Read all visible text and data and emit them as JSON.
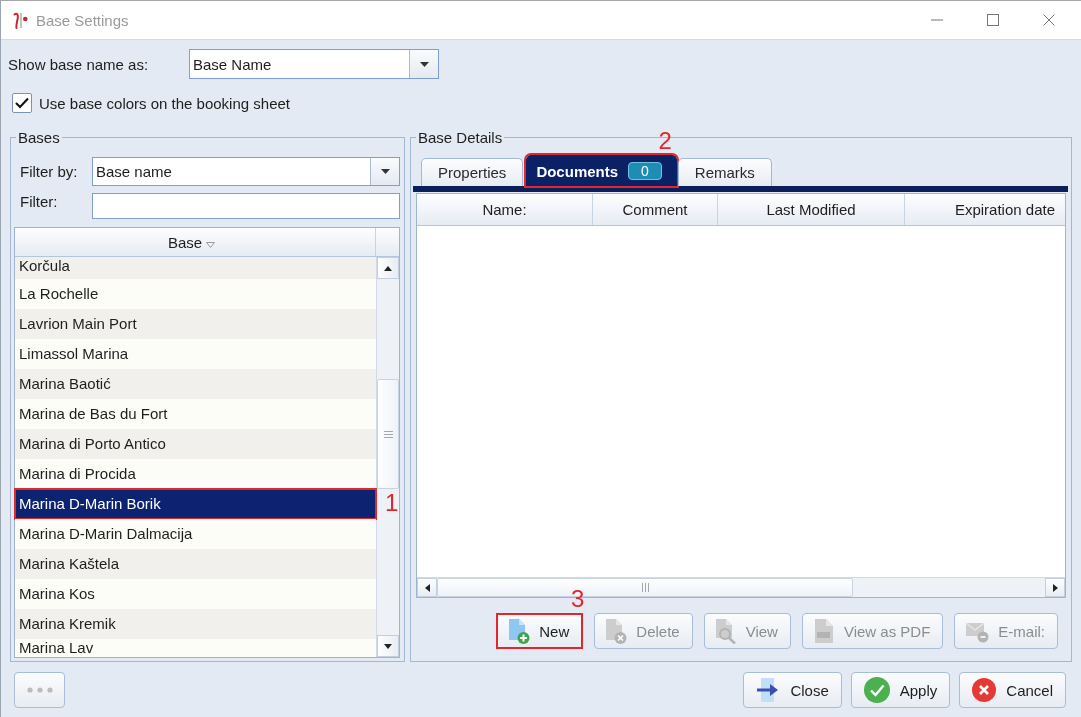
{
  "window": {
    "title": "Base Settings"
  },
  "display": {
    "label": "Show base name as:",
    "value": "Base Name"
  },
  "use_colors": {
    "label": "Use base colors on the booking sheet",
    "checked": true
  },
  "bases": {
    "title": "Bases",
    "filter_by": {
      "label": "Filter by:",
      "value": "Base name"
    },
    "filter": {
      "label": "Filter:"
    },
    "column": "Base",
    "rows": [
      {
        "name": "Korčula",
        "selected": false
      },
      {
        "name": "La Rochelle",
        "selected": false
      },
      {
        "name": "Lavrion Main Port",
        "selected": false
      },
      {
        "name": "Limassol Marina",
        "selected": false
      },
      {
        "name": "Marina Baotić",
        "selected": false
      },
      {
        "name": "Marina de Bas du Fort",
        "selected": false
      },
      {
        "name": "Marina di Porto Antico",
        "selected": false
      },
      {
        "name": "Marina di Procida",
        "selected": false
      },
      {
        "name": "Marina D-Marin Borik",
        "selected": true,
        "callout": "1"
      },
      {
        "name": "Marina D-Marin Dalmacija",
        "selected": false
      },
      {
        "name": "Marina Kaštela",
        "selected": false
      },
      {
        "name": "Marina Kos",
        "selected": false
      },
      {
        "name": "Marina Kremik",
        "selected": false
      },
      {
        "name": "Marina Lav",
        "selected": false
      }
    ]
  },
  "details": {
    "title": "Base Details",
    "tabs": [
      {
        "label": "Properties",
        "selected": false
      },
      {
        "label": "Documents",
        "selected": true,
        "badge": "0",
        "callout": "2"
      },
      {
        "label": "Remarks",
        "selected": false
      }
    ],
    "columns": [
      "Name:",
      "Comment",
      "Last Modified",
      "Expiration date"
    ],
    "actions": [
      {
        "label": "New",
        "kind": "new",
        "disabled": false,
        "callout": "3"
      },
      {
        "label": "Delete",
        "kind": "delete",
        "disabled": true
      },
      {
        "label": "View",
        "kind": "view",
        "disabled": true
      },
      {
        "label": "View as PDF",
        "kind": "pdf",
        "disabled": true
      },
      {
        "label": "E-mail:",
        "kind": "email",
        "disabled": true
      }
    ]
  },
  "more_button": {
    "disabled": true
  },
  "buttons": [
    {
      "label": "Close",
      "kind": "close"
    },
    {
      "label": "Apply",
      "kind": "apply"
    },
    {
      "label": "Cancel",
      "kind": "cancel"
    }
  ]
}
